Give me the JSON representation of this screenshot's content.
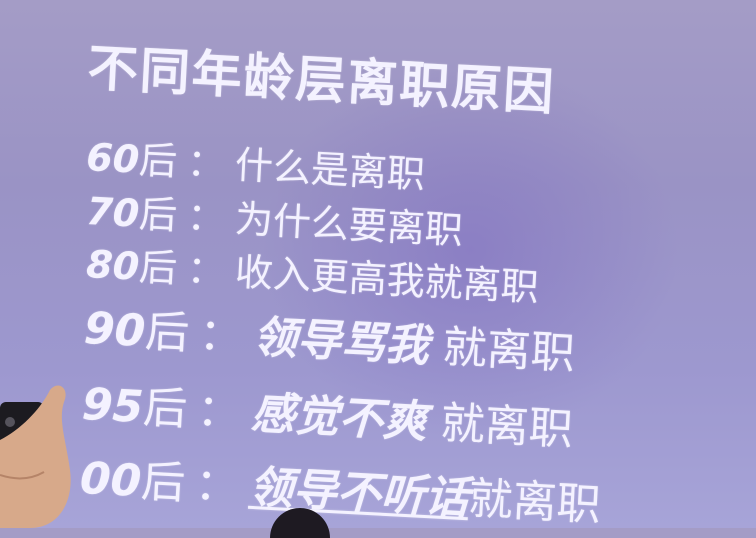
{
  "title": "不同年龄层离职原因",
  "rows": [
    {
      "era": "60",
      "suffix": "后",
      "sep": "：",
      "reason": "什么是离职"
    },
    {
      "era": "70",
      "suffix": "后",
      "sep": "：",
      "reason": "为什么要离职"
    },
    {
      "era": "80",
      "suffix": "后",
      "sep": "：",
      "reason": "收入更高我就离职"
    },
    {
      "era": "90",
      "suffix": "后",
      "sep": "：",
      "strong": "领导骂我",
      "rest": "就离职"
    },
    {
      "era": "95",
      "suffix": "后",
      "sep": "：",
      "strong": "感觉不爽",
      "rest": "就离职"
    },
    {
      "era": "00",
      "suffix": "后",
      "sep": "：",
      "strong": "领导不听话",
      "rest": "就离职"
    }
  ],
  "colors": {
    "text": "#f4f2ff",
    "background": "#9d98cf"
  },
  "icons": [
    "phone-in-hand",
    "head-silhouette"
  ]
}
